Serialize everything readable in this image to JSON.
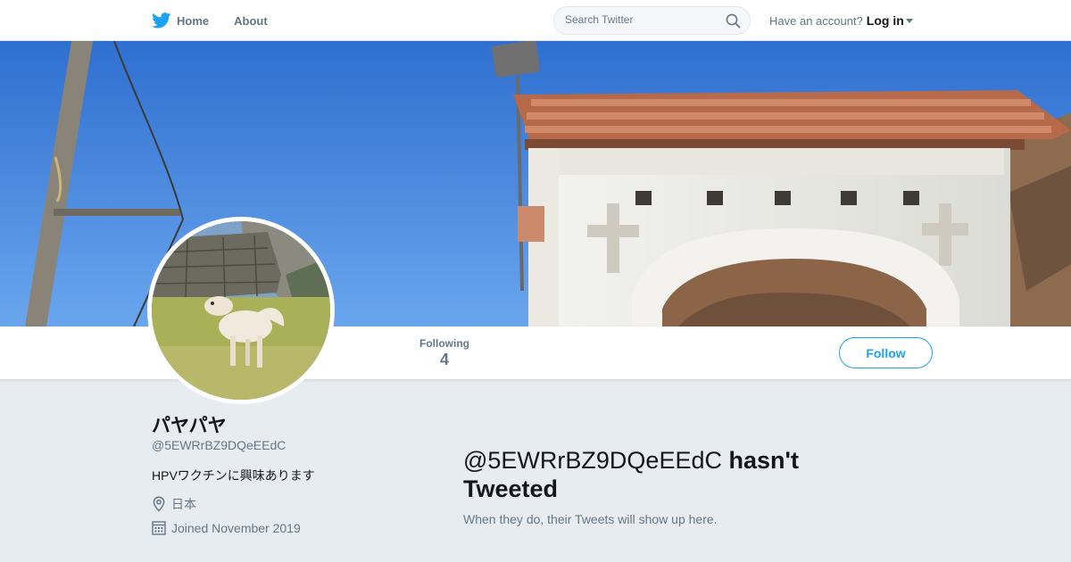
{
  "nav": {
    "home_label": "Home",
    "about_label": "About",
    "search_placeholder": "Search Twitter",
    "account_prompt": "Have an account?",
    "login_label": "Log in",
    "brand_color": "#1da1f2"
  },
  "profile_nav": {
    "following_label": "Following",
    "following_count": "4",
    "follow_button_label": "Follow"
  },
  "profile": {
    "display_name": "パヤパヤ",
    "handle": "@5EWRrBZ9DQeEEdC",
    "bio": "HPVワクチンに興味あります",
    "location": "日本",
    "joined": "Joined November 2019",
    "location_icon": "location-pin-icon",
    "joined_icon": "calendar-icon"
  },
  "timeline": {
    "empty_handle": "@5EWRrBZ9DQeEEdC",
    "empty_message": "hasn't Tweeted",
    "empty_subtext": "When they do, their Tweets will show up here."
  }
}
